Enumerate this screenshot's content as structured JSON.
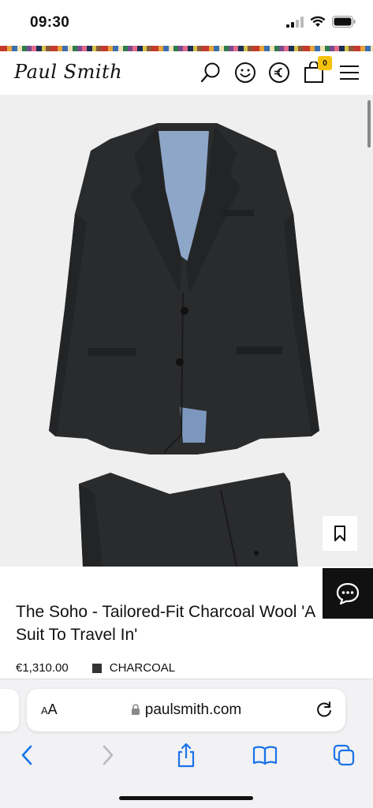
{
  "status_bar": {
    "time": "09:30"
  },
  "header": {
    "logo": "Paul Smith",
    "basket_count": "0"
  },
  "product": {
    "title": "The Soho - Tailored-Fit Charcoal Wool 'A Suit To Travel In'",
    "price": "€1,310.00",
    "colour": "CHARCOAL",
    "colour_hex": "#333333"
  },
  "browser": {
    "text_size_label_small": "A",
    "text_size_label_large": "A",
    "url": "paulsmith.com"
  },
  "colors": {
    "accent_badge": "#f4c20d",
    "ios_blue": "#1a73e8"
  }
}
